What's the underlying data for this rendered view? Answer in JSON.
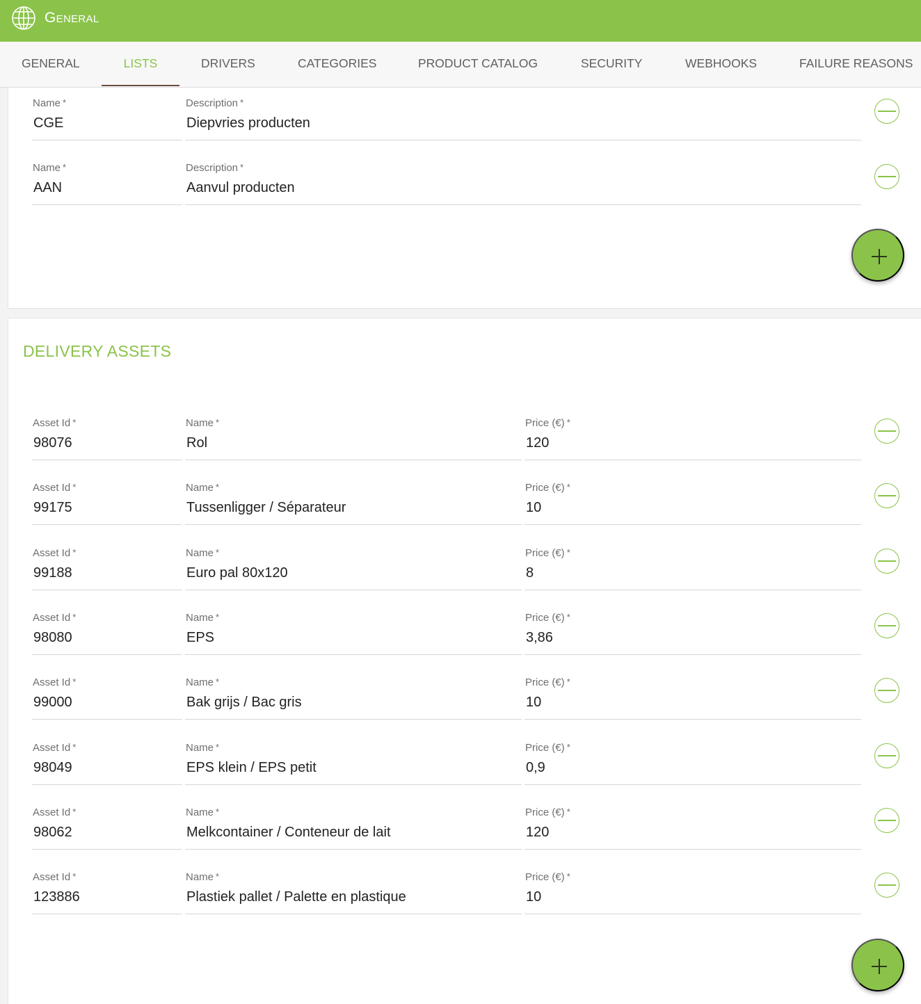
{
  "app": {
    "title": "General",
    "icon": "globe-icon",
    "accent": "#8bc34a"
  },
  "tabs": [
    {
      "label": "GENERAL",
      "active": false
    },
    {
      "label": "LISTS",
      "active": true
    },
    {
      "label": "DRIVERS",
      "active": false
    },
    {
      "label": "CATEGORIES",
      "active": false
    },
    {
      "label": "PRODUCT CATALOG",
      "active": false
    },
    {
      "label": "SECURITY",
      "active": false
    },
    {
      "label": "WEBHOOKS",
      "active": false
    },
    {
      "label": "FAILURE REASONS",
      "active": false
    }
  ],
  "list_items": {
    "name_label": "Name",
    "description_label": "Description",
    "required_mark": "*",
    "rows": [
      {
        "name": "CGE",
        "description": "Diepvries producten"
      },
      {
        "name": "AAN",
        "description": "Aanvul producten"
      }
    ]
  },
  "delivery_assets": {
    "title": "DELIVERY ASSETS",
    "asset_id_label": "Asset Id",
    "name_label": "Name",
    "price_label": "Price (€)",
    "required_mark": "*",
    "rows": [
      {
        "asset_id": "98076",
        "name": "Rol",
        "price": "120"
      },
      {
        "asset_id": "99175",
        "name": "Tussenligger / Séparateur",
        "price": "10"
      },
      {
        "asset_id": "99188",
        "name": "Euro pal 80x120",
        "price": "8"
      },
      {
        "asset_id": "98080",
        "name": "EPS",
        "price": "3,86"
      },
      {
        "asset_id": "99000",
        "name": "Bak grijs / Bac gris",
        "price": "10"
      },
      {
        "asset_id": "98049",
        "name": "EPS klein / EPS petit",
        "price": "0,9"
      },
      {
        "asset_id": "98062",
        "name": "Melkcontainer / Conteneur de lait",
        "price": "120"
      },
      {
        "asset_id": "123886",
        "name": "Plastiek pallet / Palette en plastique",
        "price": "10"
      }
    ]
  }
}
